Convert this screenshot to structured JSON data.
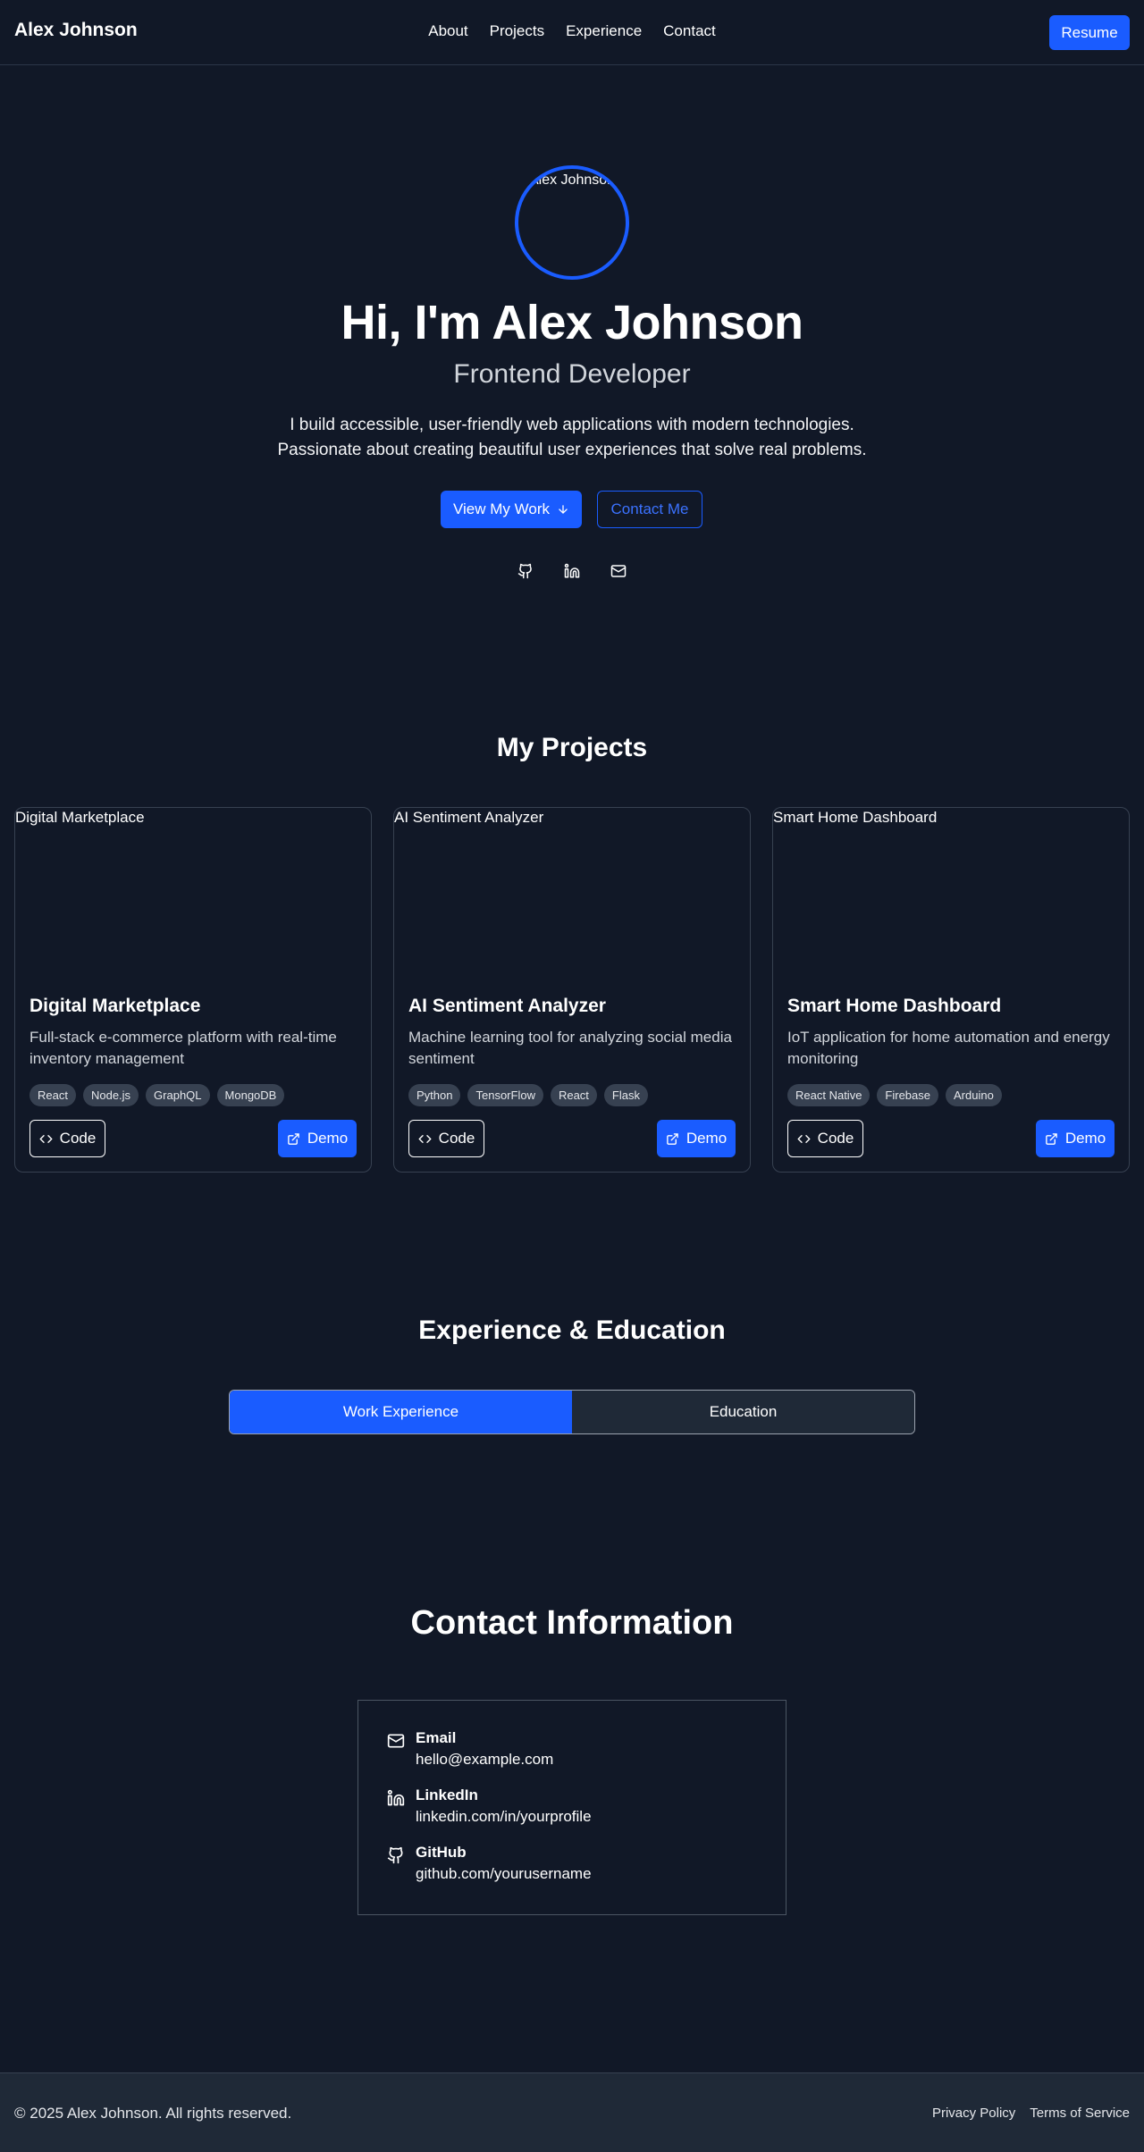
{
  "nav": {
    "brand": "Alex Johnson",
    "links": [
      "About",
      "Projects",
      "Experience",
      "Contact"
    ],
    "resume_label": "Resume"
  },
  "hero": {
    "avatar_alt": "Alex Johnson",
    "title": "Hi, I'm Alex Johnson",
    "subtitle": "Frontend Developer",
    "description_line1": "I build accessible, user-friendly web applications with modern technologies.",
    "description_line2": "Passionate about creating beautiful user experiences that solve real problems.",
    "view_work_label": "View My Work",
    "contact_me_label": "Contact Me",
    "social_icons": [
      "github-icon",
      "linkedin-icon",
      "mail-icon"
    ]
  },
  "projects": {
    "title": "My Projects",
    "items": [
      {
        "image_alt": "Digital Marketplace",
        "title": "Digital Marketplace",
        "description": "Full-stack e-commerce platform with real-time inventory management",
        "tags": [
          "React",
          "Node.js",
          "GraphQL",
          "MongoDB"
        ],
        "code_label": "Code",
        "demo_label": "Demo"
      },
      {
        "image_alt": "AI Sentiment Analyzer",
        "title": "AI Sentiment Analyzer",
        "description": "Machine learning tool for analyzing social media sentiment",
        "tags": [
          "Python",
          "TensorFlow",
          "React",
          "Flask"
        ],
        "code_label": "Code",
        "demo_label": "Demo"
      },
      {
        "image_alt": "Smart Home Dashboard",
        "title": "Smart Home Dashboard",
        "description": "IoT application for home automation and energy monitoring",
        "tags": [
          "React Native",
          "Firebase",
          "Arduino"
        ],
        "code_label": "Code",
        "demo_label": "Demo"
      }
    ]
  },
  "experience": {
    "title": "Experience & Education",
    "tabs": [
      "Work Experience",
      "Education"
    ],
    "active_tab": "Work Experience"
  },
  "contact": {
    "title": "Contact Information",
    "items": [
      {
        "icon": "mail-icon",
        "label": "Email",
        "value": "hello@example.com"
      },
      {
        "icon": "linkedin-icon",
        "label": "LinkedIn",
        "value": "linkedin.com/in/yourprofile"
      },
      {
        "icon": "github-icon",
        "label": "GitHub",
        "value": "github.com/yourusername"
      }
    ]
  },
  "footer": {
    "copyright": "© 2025 Alex Johnson. All rights reserved.",
    "links": [
      "Privacy Policy",
      "Terms of Service"
    ]
  },
  "colors": {
    "background": "#111827",
    "accent": "#1a5cff",
    "footer": "#1f2937"
  }
}
